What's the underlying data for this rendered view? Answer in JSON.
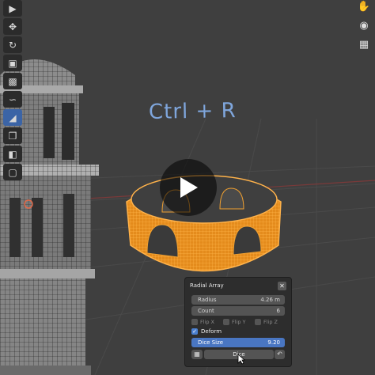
{
  "annotation_text": "Ctrl + R",
  "toolbar": {
    "tools": [
      "select-icon",
      "move-icon",
      "rotate-icon",
      "scale-icon",
      "transform-icon",
      "annotate-icon",
      "measure-icon",
      "add-cube-icon",
      "extrude-icon",
      "inset-icon"
    ]
  },
  "nav": {
    "icons": [
      "hand-icon",
      "camera-icon",
      "grid-view-icon"
    ]
  },
  "operator_panel": {
    "title": "Radial Array",
    "radius": {
      "label": "Radius",
      "value": "4.26 m"
    },
    "count": {
      "label": "Count",
      "value": "6"
    },
    "flip_x": "Flip X",
    "flip_y": "Flip Y",
    "flip_z": "Flip Z",
    "deform": {
      "label": "Deform",
      "checked": true
    },
    "dice_size": {
      "label": "Dice Size",
      "value": "9.20"
    },
    "dice_button": "Dice"
  },
  "colors": {
    "viewport": "#3f3f3f",
    "selection": "#f5a623",
    "accent": "#4976c2"
  }
}
